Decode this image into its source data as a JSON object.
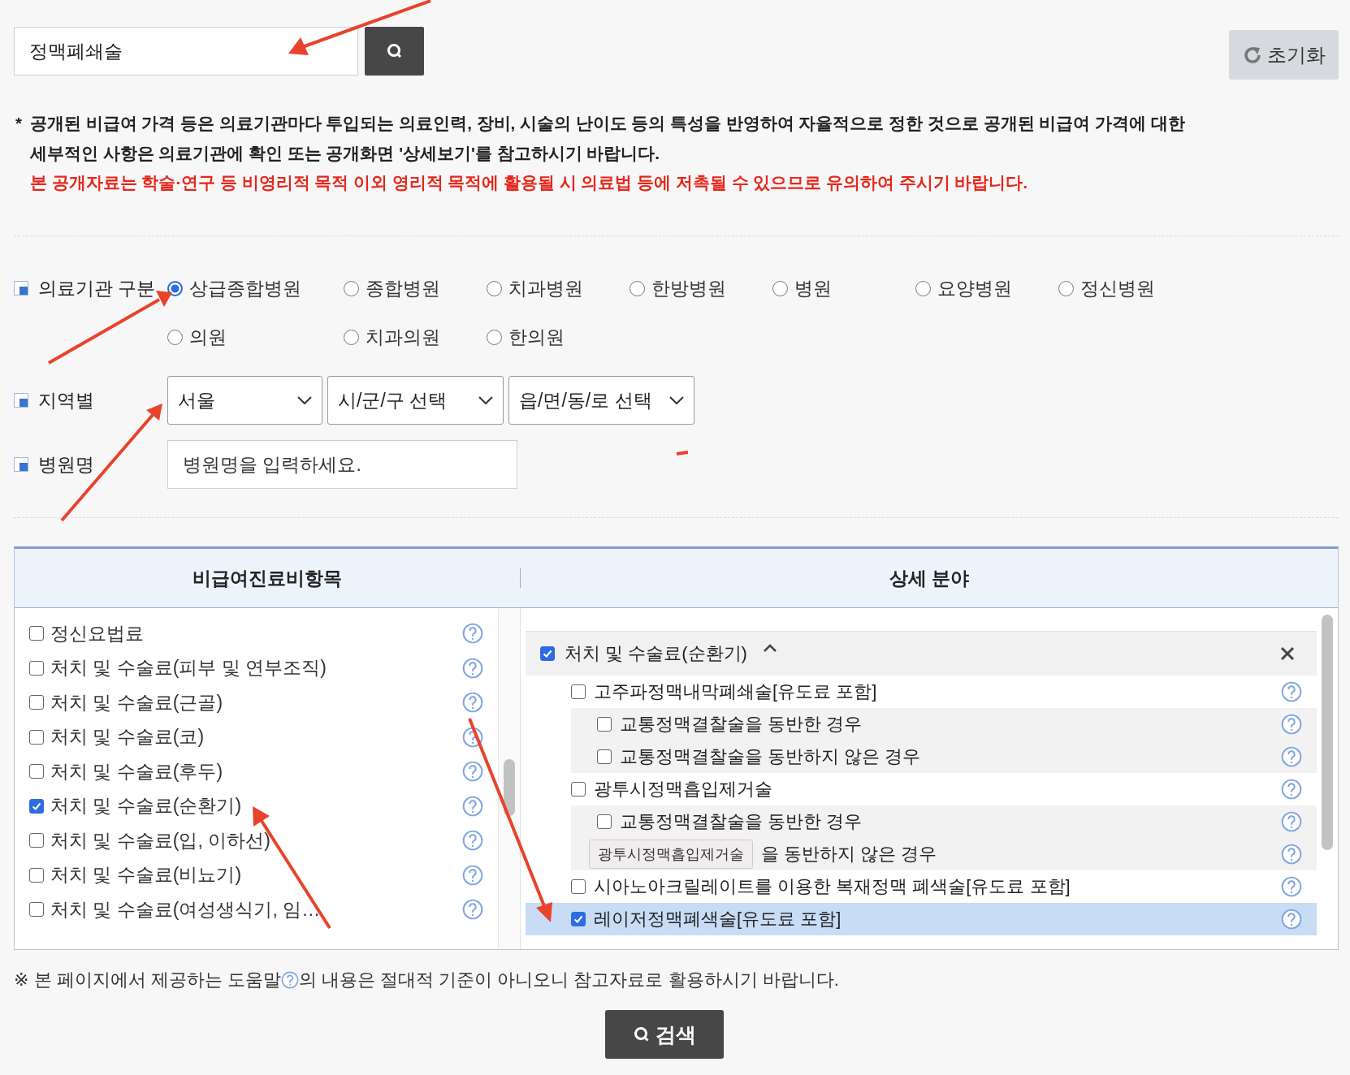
{
  "search": {
    "value": "정맥폐쇄술"
  },
  "reset_button": {
    "label": "초기화"
  },
  "notice": {
    "marker": "*",
    "lines": [
      "공개된 비급여 가격 등은 의료기관마다 투입되는 의료인력, 장비, 시술의 난이도 등의 특성을 반영하여 자율적으로 정한 것으로 공개된 비급여 가격에 대한",
      "세부적인 사항은 의료기관에 확인 또는 공개화면 '상세보기'를 참고하시기 바랍니다."
    ],
    "warning": "본 공개자료는 학술·연구 등 비영리적 목적 이외 영리적 목적에 활용될 시 의료법 등에 저촉될 수 있으므로 유의하여 주시기 바랍니다."
  },
  "filters": {
    "institution_type": {
      "label": "의료기관 구분",
      "options": [
        {
          "label": "상급종합병원",
          "selected": true
        },
        {
          "label": "종합병원",
          "selected": false
        },
        {
          "label": "치과병원",
          "selected": false
        },
        {
          "label": "한방병원",
          "selected": false
        },
        {
          "label": "병원",
          "selected": false
        },
        {
          "label": "요양병원",
          "selected": false
        },
        {
          "label": "정신병원",
          "selected": false
        },
        {
          "label": "의원",
          "selected": false
        },
        {
          "label": "치과의원",
          "selected": false
        },
        {
          "label": "한의원",
          "selected": false
        }
      ]
    },
    "region": {
      "label": "지역별",
      "selects": [
        {
          "value": "서울"
        },
        {
          "value": "시/군/구 선택"
        },
        {
          "value": "읍/면/동/로 선택"
        }
      ]
    },
    "hospital_name": {
      "label": "병원명",
      "placeholder": "병원명을 입력하세요."
    }
  },
  "panel": {
    "left_header": "비급여진료비항목",
    "right_header": "상세 분야",
    "categories": [
      {
        "label": "정신요법료",
        "checked": false
      },
      {
        "label": "처치 및 수술료(피부 및 연부조직)",
        "checked": false
      },
      {
        "label": "처치 및 수술료(근골)",
        "checked": false
      },
      {
        "label": "처치 및 수술료(코)",
        "checked": false
      },
      {
        "label": "처치 및 수술료(후두)",
        "checked": false
      },
      {
        "label": "처치 및 수술료(순환기)",
        "checked": true
      },
      {
        "label": "처치 및 수술료(입, 이하선)",
        "checked": false
      },
      {
        "label": "처치 및 수술료(비뇨기)",
        "checked": false
      },
      {
        "label": "처치 및 수술료(여성생식기, 임…",
        "checked": false
      }
    ],
    "group": {
      "label": "처치 및 수술료(순환기)",
      "checked": true,
      "expanded": true
    },
    "details": [
      {
        "label": "고주파정맥내막폐쇄술[유도료 포함]",
        "checked": false,
        "selected": false,
        "children": [
          {
            "label": "교통정맥결찰술을 동반한 경우",
            "checked": false,
            "selected": false,
            "kind": "normal"
          },
          {
            "label": "교통정맥결찰술을 동반하지 않은 경우",
            "checked": false,
            "selected": false,
            "kind": "normal"
          }
        ]
      },
      {
        "label": "광투시정맥흡입제거술",
        "checked": false,
        "selected": false,
        "children": [
          {
            "label": "교통정맥결찰술을 동반한 경우",
            "checked": false,
            "selected": false,
            "kind": "normal"
          },
          {
            "label": "을 동반하지 않은 경우",
            "selected": false,
            "kind": "covered"
          }
        ]
      },
      {
        "label": "시아노아크릴레이트를 이용한 복재정맥 폐색술[유도료 포함]",
        "checked": false,
        "selected": false
      },
      {
        "label": "레이저정맥폐색술[유도료 포함]",
        "checked": true,
        "selected": true
      }
    ],
    "tooltip": "광투시정맥흡입제거술"
  },
  "help_note": {
    "before": "※ 본 페이지에서 제공하는 도움말",
    "after": "의 내용은 절대적 기준이 아니오니 참고자료로 활용하시기 바랍니다."
  },
  "search_button": {
    "label": "검색"
  }
}
